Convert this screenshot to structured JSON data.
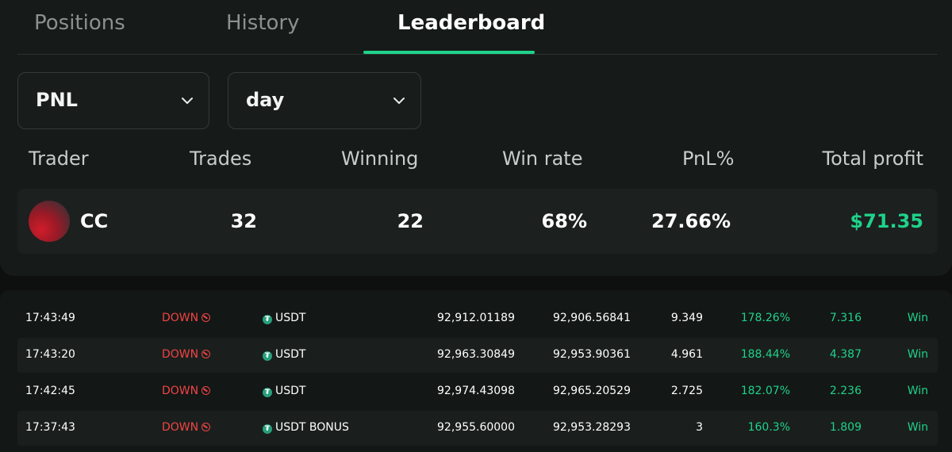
{
  "tabs": {
    "positions": "Positions",
    "history": "History",
    "leaderboard": "Leaderboard"
  },
  "filters": {
    "metric": "PNL",
    "period": "day"
  },
  "leaderboard": {
    "headers": {
      "trader": "Trader",
      "trades": "Trades",
      "winning": "Winning",
      "win_rate": "Win rate",
      "pnl_pct": "PnL%",
      "total_profit": "Total profit"
    },
    "rows": [
      {
        "trader": "CC",
        "trades": "32",
        "winning": "22",
        "win_rate": "68%",
        "pnl_pct": "27.66%",
        "total_profit": "$71.35"
      }
    ]
  },
  "trades": [
    {
      "time": "17:43:49",
      "direction": "DOWN",
      "asset": "USDT",
      "open": "92,912.01189",
      "close": "92,906.56841",
      "amount": "9.349",
      "payout": "178.26%",
      "profit": "7.316",
      "result": "Win"
    },
    {
      "time": "17:43:20",
      "direction": "DOWN",
      "asset": "USDT",
      "open": "92,963.30849",
      "close": "92,953.90361",
      "amount": "4.961",
      "payout": "188.44%",
      "profit": "4.387",
      "result": "Win"
    },
    {
      "time": "17:42:45",
      "direction": "DOWN",
      "asset": "USDT",
      "open": "92,974.43098",
      "close": "92,965.20529",
      "amount": "2.725",
      "payout": "182.07%",
      "profit": "2.236",
      "result": "Win"
    },
    {
      "time": "17:37:43",
      "direction": "DOWN",
      "asset": "USDT BONUS",
      "open": "92,955.60000",
      "close": "92,953.28293",
      "amount": "3",
      "payout": "160.3%",
      "profit": "1.809",
      "result": "Win"
    }
  ],
  "colors": {
    "accent": "#1fd28a",
    "down": "#f04444",
    "token": "#26a17b"
  }
}
